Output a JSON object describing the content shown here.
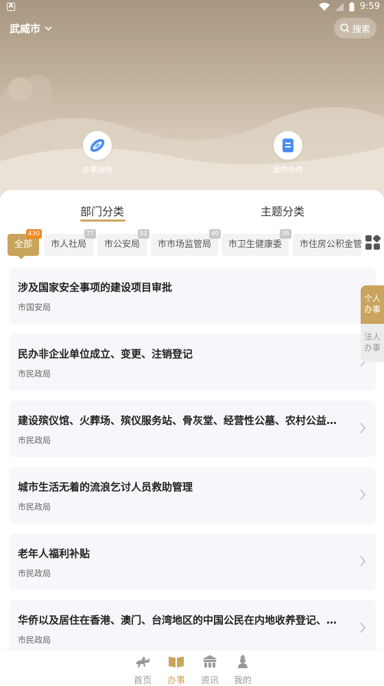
{
  "status_bar": {
    "left_badge": "A",
    "time": "9:59"
  },
  "header": {
    "city": "武威市",
    "search_label": "搜索"
  },
  "shortcuts": [
    {
      "label": "办事指南",
      "icon": "compass-icon"
    },
    {
      "label": "我的办件",
      "icon": "document-icon"
    }
  ],
  "tabs": [
    {
      "label": "部门分类",
      "active": true
    },
    {
      "label": "主题分类",
      "active": false
    }
  ],
  "chips": [
    {
      "label": "全部",
      "count": "430",
      "active": true
    },
    {
      "label": "市人社局",
      "count": "77",
      "active": false
    },
    {
      "label": "市公安局",
      "count": "52",
      "active": false
    },
    {
      "label": "市市场监管局",
      "count": "40",
      "active": false
    },
    {
      "label": "市卫生健康委",
      "count": "36",
      "active": false
    },
    {
      "label": "市住房公积金管",
      "count": "",
      "active": false
    }
  ],
  "items": [
    {
      "title": "涉及国家安全事项的建设项目审批",
      "dept": "市国安局"
    },
    {
      "title": "民办非企业单位成立、变更、注销登记",
      "dept": "市民政局"
    },
    {
      "title": "建设殡仪馆、火葬场、殡仪服务站、骨灰堂、经营性公墓、农村公益性...",
      "dept": "市民政局"
    },
    {
      "title": "城市生活无着的流浪乞讨人员救助管理",
      "dept": "市民政局"
    },
    {
      "title": "老年人福利补贴",
      "dept": "市民政局"
    },
    {
      "title": "华侨以及居住在香港、澳门、台湾地区的中国公民在内地收养登记、解...",
      "dept": "市民政局"
    }
  ],
  "side_tabs": [
    {
      "label_line1": "个人",
      "label_line2": "办事",
      "active": true
    },
    {
      "label_line1": "法人",
      "label_line2": "办事",
      "active": false
    }
  ],
  "bottom_nav": [
    {
      "label": "首页",
      "icon": "horse-icon",
      "active": false
    },
    {
      "label": "办事",
      "icon": "book-icon",
      "active": true
    },
    {
      "label": "资讯",
      "icon": "building-icon",
      "active": false
    },
    {
      "label": "我的",
      "icon": "person-icon",
      "active": false
    }
  ],
  "colors": {
    "accent": "#c9a45c",
    "badge_orange": "#f08a24"
  }
}
